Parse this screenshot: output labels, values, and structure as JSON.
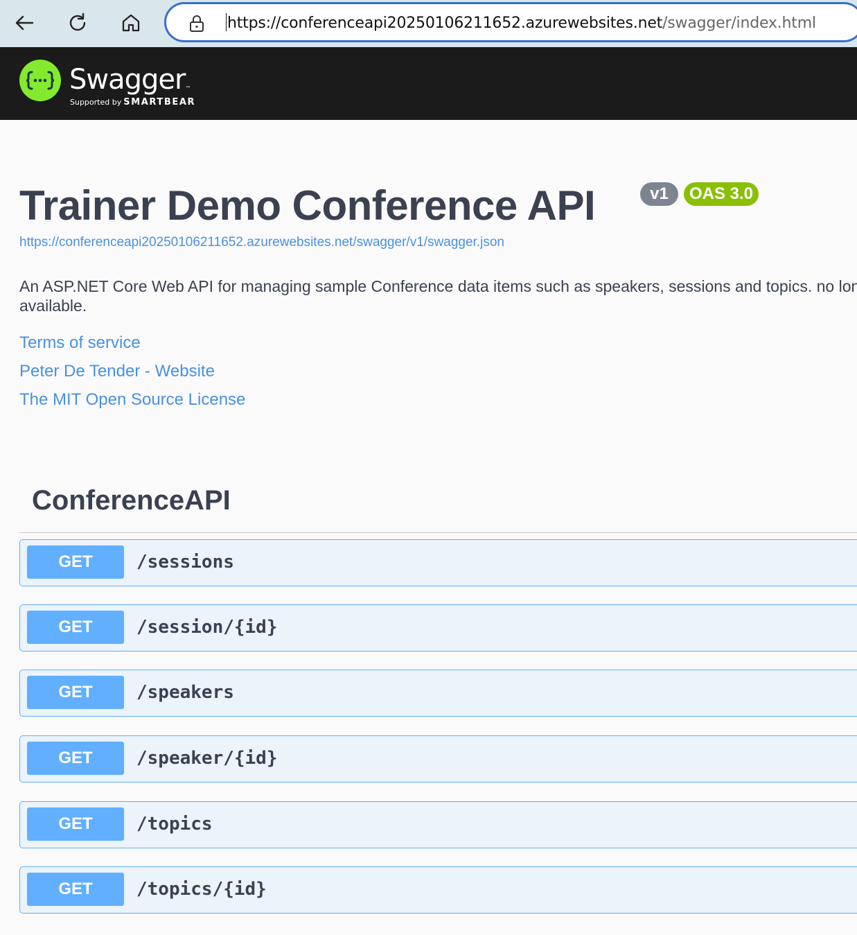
{
  "browser": {
    "url_host": "https://conferenceapi20250106211652.azurewebsites.net",
    "url_path": "/swagger/index.html"
  },
  "topbar": {
    "logo_text": "Swagger",
    "supported_by": "Supported by",
    "brand": "SMARTBEAR",
    "logo_color": "#85ea2d"
  },
  "info": {
    "title": "Trainer Demo Conference API",
    "version_badge": "v1",
    "oas_badge": "OAS 3.0",
    "spec_url": "https://conferenceapi20250106211652.azurewebsites.net/swagger/v1/swagger.json",
    "description": "An ASP.NET Core Web API for managing sample Conference data items such as speakers, sessions and topics. no longer available.",
    "links": {
      "terms": "Terms of service",
      "contact": "Peter De Tender - Website",
      "license": "The MIT Open Source License"
    }
  },
  "tag": {
    "name": "ConferenceAPI"
  },
  "operations": [
    {
      "method": "GET",
      "path": "/sessions"
    },
    {
      "method": "GET",
      "path": "/session/{id}"
    },
    {
      "method": "GET",
      "path": "/speakers"
    },
    {
      "method": "GET",
      "path": "/speaker/{id}"
    },
    {
      "method": "GET",
      "path": "/topics"
    },
    {
      "method": "GET",
      "path": "/topics/{id}"
    }
  ],
  "colors": {
    "get_method": "#61affe",
    "get_background": "#ebf3fb",
    "link": "#4990e2",
    "oas_badge": "#89bf04",
    "version_badge": "#7d8492"
  }
}
